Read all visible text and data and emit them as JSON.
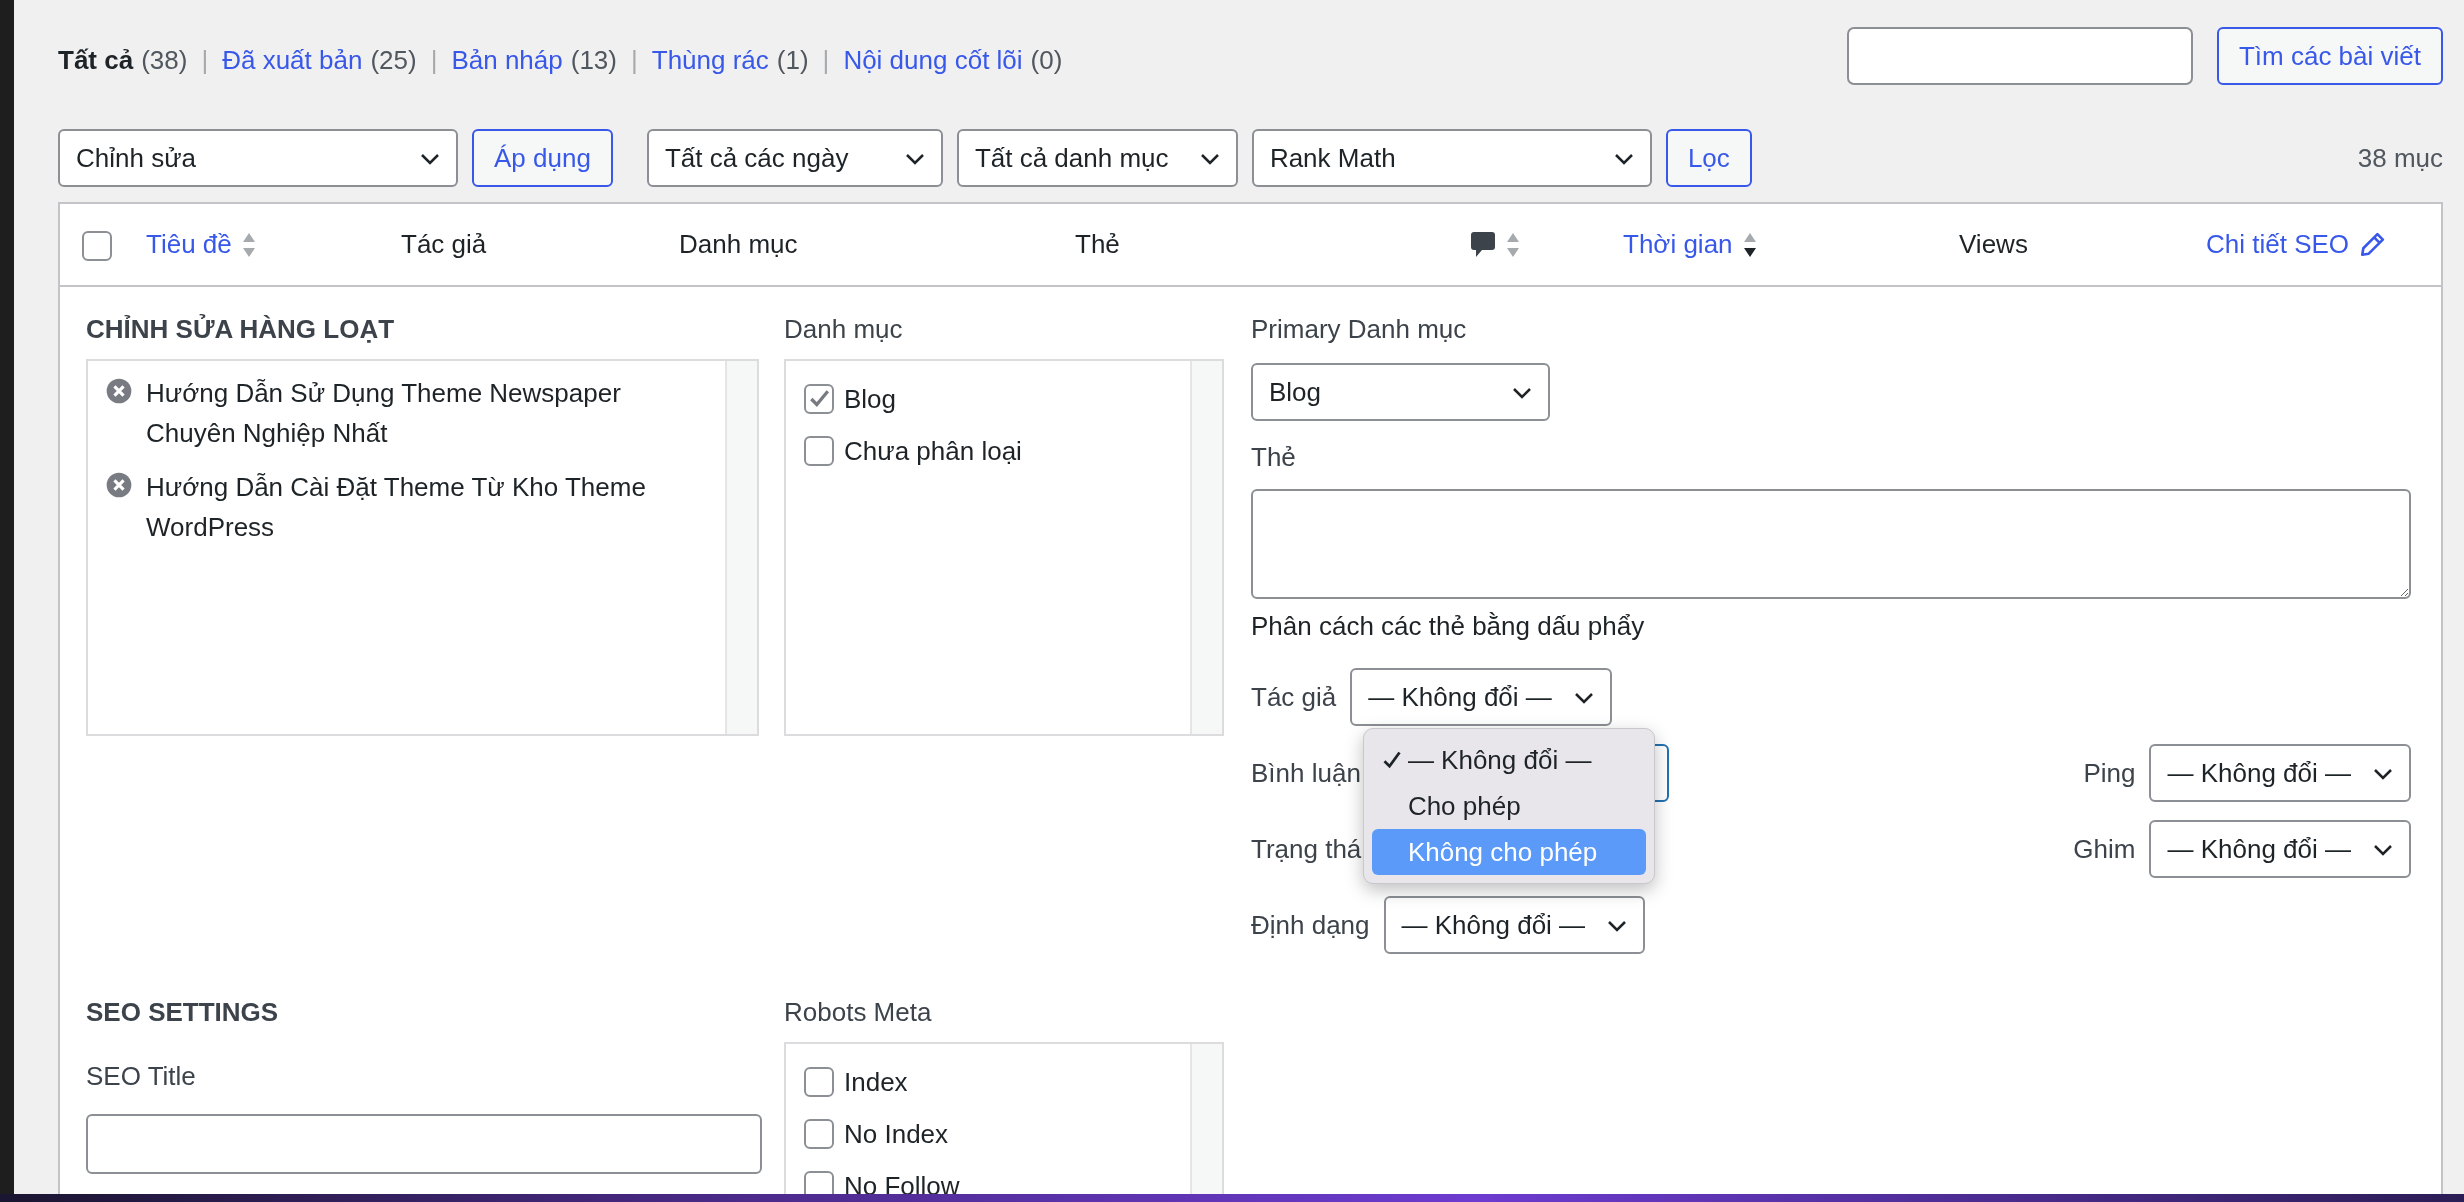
{
  "status_links": [
    {
      "label": "Tất cả",
      "count": "(38)",
      "selected": true
    },
    {
      "label": "Đã xuất bản",
      "count": "(25)",
      "selected": false
    },
    {
      "label": "Bản nháp",
      "count": "(13)",
      "selected": false
    },
    {
      "label": "Thùng rác",
      "count": "(1)",
      "selected": false
    },
    {
      "label": "Nội dung cốt lõi",
      "count": "(0)",
      "selected": false
    }
  ],
  "separator": "|",
  "search": {
    "button": "Tìm các bài viết"
  },
  "bulk_actions": {
    "select": "Chỉnh sửa",
    "button": "Áp dụng"
  },
  "filters": {
    "selects": [
      "Tất cả các ngày",
      "Tất cả danh mục",
      "Rank Math"
    ],
    "button": "Lọc"
  },
  "item_count": "38 mục",
  "table": {
    "select_all": {
      "checked": false
    },
    "columns": [
      {
        "label": "Tiêu đề",
        "kind": "sortable"
      },
      {
        "label": "Tác giả",
        "kind": "plain"
      },
      {
        "label": "Danh mục",
        "kind": "plain"
      },
      {
        "label": "Thẻ",
        "kind": "plain"
      },
      {
        "kind": "comments"
      },
      {
        "label": "Thời gian",
        "kind": "sorted"
      },
      {
        "label": "Views",
        "kind": "plain"
      },
      {
        "label": "Chi tiết SEO",
        "kind": "edit"
      }
    ]
  },
  "bulk_edit": {
    "title": "CHỈNH SỬA HÀNG LOẠT",
    "posts": [
      "Hướng Dẫn Sử Dụng Theme Newspaper Chuyên Nghiệp Nhất",
      "Hướng Dẫn Cài Đặt Theme Từ Kho Theme WordPress"
    ],
    "categories_label": "Danh mục",
    "categories": [
      {
        "label": "Blog",
        "checked": true
      },
      {
        "label": "Chưa phân loại",
        "checked": false
      }
    ],
    "primary_label": "Primary Danh mục",
    "primary_value": "Blog",
    "tags_label": "Thẻ",
    "tags_hint": "Phân cách các thẻ bằng dấu phẩy",
    "fields": [
      {
        "left": {
          "label": "Tác giả",
          "value": "— Không đổi —"
        }
      },
      {
        "left": {
          "label": "Bình luận",
          "focused": true
        },
        "right": {
          "label": "Ping",
          "value": "— Không đổi —"
        }
      },
      {
        "left": {
          "label": "Trạng thá"
        },
        "right": {
          "label": "Ghim",
          "value": "— Không đổi —"
        }
      },
      {
        "left": {
          "label": "Định dạng",
          "value": "— Không đổi —"
        }
      }
    ]
  },
  "dropdown": {
    "options": [
      {
        "label": "— Không đổi —",
        "checked": true,
        "selected": false
      },
      {
        "label": "Cho phép",
        "checked": false,
        "selected": false
      },
      {
        "label": "Không cho phép",
        "checked": false,
        "selected": true
      }
    ]
  },
  "seo": {
    "title": "SEO SETTINGS",
    "seo_title_label": "SEO Title",
    "robots_label": "Robots Meta",
    "robots": [
      {
        "label": "Index",
        "checked": false
      },
      {
        "label": "No Index",
        "checked": false
      },
      {
        "label": "No Follow",
        "checked": false
      }
    ]
  }
}
